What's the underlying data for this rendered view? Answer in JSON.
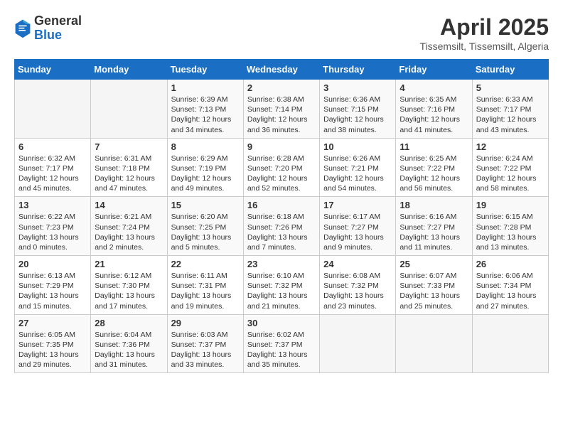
{
  "header": {
    "logo_general": "General",
    "logo_blue": "Blue",
    "month_title": "April 2025",
    "location": "Tissemsilt, Tissemsilt, Algeria"
  },
  "days_of_week": [
    "Sunday",
    "Monday",
    "Tuesday",
    "Wednesday",
    "Thursday",
    "Friday",
    "Saturday"
  ],
  "weeks": [
    [
      {
        "day": "",
        "info": ""
      },
      {
        "day": "",
        "info": ""
      },
      {
        "day": "1",
        "info": "Sunrise: 6:39 AM\nSunset: 7:13 PM\nDaylight: 12 hours and 34 minutes."
      },
      {
        "day": "2",
        "info": "Sunrise: 6:38 AM\nSunset: 7:14 PM\nDaylight: 12 hours and 36 minutes."
      },
      {
        "day": "3",
        "info": "Sunrise: 6:36 AM\nSunset: 7:15 PM\nDaylight: 12 hours and 38 minutes."
      },
      {
        "day": "4",
        "info": "Sunrise: 6:35 AM\nSunset: 7:16 PM\nDaylight: 12 hours and 41 minutes."
      },
      {
        "day": "5",
        "info": "Sunrise: 6:33 AM\nSunset: 7:17 PM\nDaylight: 12 hours and 43 minutes."
      }
    ],
    [
      {
        "day": "6",
        "info": "Sunrise: 6:32 AM\nSunset: 7:17 PM\nDaylight: 12 hours and 45 minutes."
      },
      {
        "day": "7",
        "info": "Sunrise: 6:31 AM\nSunset: 7:18 PM\nDaylight: 12 hours and 47 minutes."
      },
      {
        "day": "8",
        "info": "Sunrise: 6:29 AM\nSunset: 7:19 PM\nDaylight: 12 hours and 49 minutes."
      },
      {
        "day": "9",
        "info": "Sunrise: 6:28 AM\nSunset: 7:20 PM\nDaylight: 12 hours and 52 minutes."
      },
      {
        "day": "10",
        "info": "Sunrise: 6:26 AM\nSunset: 7:21 PM\nDaylight: 12 hours and 54 minutes."
      },
      {
        "day": "11",
        "info": "Sunrise: 6:25 AM\nSunset: 7:22 PM\nDaylight: 12 hours and 56 minutes."
      },
      {
        "day": "12",
        "info": "Sunrise: 6:24 AM\nSunset: 7:22 PM\nDaylight: 12 hours and 58 minutes."
      }
    ],
    [
      {
        "day": "13",
        "info": "Sunrise: 6:22 AM\nSunset: 7:23 PM\nDaylight: 13 hours and 0 minutes."
      },
      {
        "day": "14",
        "info": "Sunrise: 6:21 AM\nSunset: 7:24 PM\nDaylight: 13 hours and 2 minutes."
      },
      {
        "day": "15",
        "info": "Sunrise: 6:20 AM\nSunset: 7:25 PM\nDaylight: 13 hours and 5 minutes."
      },
      {
        "day": "16",
        "info": "Sunrise: 6:18 AM\nSunset: 7:26 PM\nDaylight: 13 hours and 7 minutes."
      },
      {
        "day": "17",
        "info": "Sunrise: 6:17 AM\nSunset: 7:27 PM\nDaylight: 13 hours and 9 minutes."
      },
      {
        "day": "18",
        "info": "Sunrise: 6:16 AM\nSunset: 7:27 PM\nDaylight: 13 hours and 11 minutes."
      },
      {
        "day": "19",
        "info": "Sunrise: 6:15 AM\nSunset: 7:28 PM\nDaylight: 13 hours and 13 minutes."
      }
    ],
    [
      {
        "day": "20",
        "info": "Sunrise: 6:13 AM\nSunset: 7:29 PM\nDaylight: 13 hours and 15 minutes."
      },
      {
        "day": "21",
        "info": "Sunrise: 6:12 AM\nSunset: 7:30 PM\nDaylight: 13 hours and 17 minutes."
      },
      {
        "day": "22",
        "info": "Sunrise: 6:11 AM\nSunset: 7:31 PM\nDaylight: 13 hours and 19 minutes."
      },
      {
        "day": "23",
        "info": "Sunrise: 6:10 AM\nSunset: 7:32 PM\nDaylight: 13 hours and 21 minutes."
      },
      {
        "day": "24",
        "info": "Sunrise: 6:08 AM\nSunset: 7:32 PM\nDaylight: 13 hours and 23 minutes."
      },
      {
        "day": "25",
        "info": "Sunrise: 6:07 AM\nSunset: 7:33 PM\nDaylight: 13 hours and 25 minutes."
      },
      {
        "day": "26",
        "info": "Sunrise: 6:06 AM\nSunset: 7:34 PM\nDaylight: 13 hours and 27 minutes."
      }
    ],
    [
      {
        "day": "27",
        "info": "Sunrise: 6:05 AM\nSunset: 7:35 PM\nDaylight: 13 hours and 29 minutes."
      },
      {
        "day": "28",
        "info": "Sunrise: 6:04 AM\nSunset: 7:36 PM\nDaylight: 13 hours and 31 minutes."
      },
      {
        "day": "29",
        "info": "Sunrise: 6:03 AM\nSunset: 7:37 PM\nDaylight: 13 hours and 33 minutes."
      },
      {
        "day": "30",
        "info": "Sunrise: 6:02 AM\nSunset: 7:37 PM\nDaylight: 13 hours and 35 minutes."
      },
      {
        "day": "",
        "info": ""
      },
      {
        "day": "",
        "info": ""
      },
      {
        "day": "",
        "info": ""
      }
    ]
  ]
}
